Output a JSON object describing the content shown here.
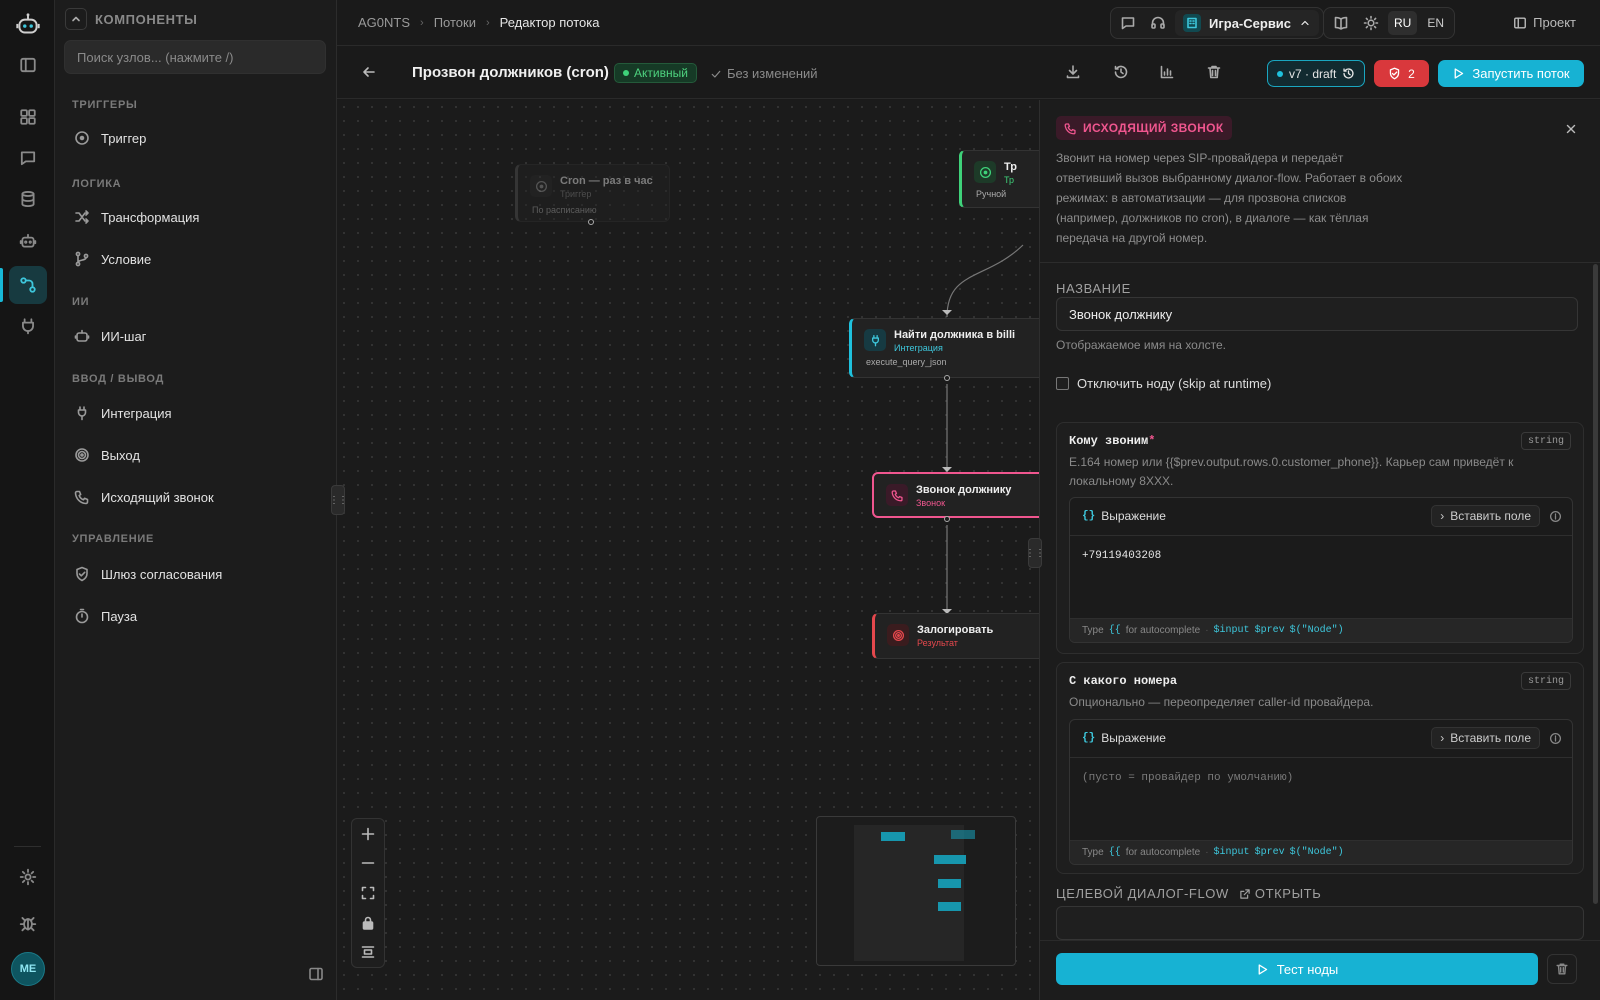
{
  "rail": {
    "avatar": "ME"
  },
  "sidebar": {
    "title": "КОМПОНЕНТЫ",
    "search_placeholder": "Поиск узлов... (нажмите /)",
    "groups": [
      {
        "label": "ТРИГГЕРЫ",
        "items": [
          {
            "label": "Триггер",
            "icon": "trigger-icon"
          }
        ]
      },
      {
        "label": "ЛОГИКА",
        "items": [
          {
            "label": "Трансформация",
            "icon": "shuffle-icon"
          },
          {
            "label": "Условие",
            "icon": "branch-icon"
          }
        ]
      },
      {
        "label": "ИИ",
        "items": [
          {
            "label": "ИИ-шаг",
            "icon": "robot-icon"
          }
        ]
      },
      {
        "label": "ВВОД / ВЫВОД",
        "items": [
          {
            "label": "Интеграция",
            "icon": "plug-icon"
          },
          {
            "label": "Выход",
            "icon": "target-icon"
          },
          {
            "label": "Исходящий звонок",
            "icon": "phone-icon"
          }
        ]
      },
      {
        "label": "УПРАВЛЕНИЕ",
        "items": [
          {
            "label": "Шлюз согласования",
            "icon": "shield-check-icon"
          },
          {
            "label": "Пауза",
            "icon": "timer-icon"
          }
        ]
      }
    ]
  },
  "topbar": {
    "breadcrumbs": [
      "AG0NTS",
      "Потоки",
      "Редактор потока"
    ],
    "tenant": "Игра-Сервис",
    "lang_ru": "RU",
    "lang_en": "EN",
    "project": "Проект"
  },
  "flow": {
    "title": "Прозвон должников (cron)",
    "status": "Активный",
    "saved": "Без изменений",
    "version": "v7 · draft",
    "alerts": "2",
    "run": "Запустить поток"
  },
  "canvas": {
    "nodes": [
      {
        "title": "Cron — раз в час",
        "subtitle": "Триггер",
        "detail": "По расписанию",
        "color": "#555555"
      },
      {
        "title": "Тр",
        "subtitle": "Тр",
        "detail": "Ручной",
        "color": "#3fd27a"
      },
      {
        "title": "Найти должника в billi",
        "subtitle": "Интеграция",
        "detail": "execute_query_json",
        "color": "#1fc1dd"
      },
      {
        "title": "Звонок должнику",
        "subtitle": "Звонок",
        "color": "#f0568f"
      },
      {
        "title": "Залогировать",
        "subtitle": "Результат",
        "color": "#e5484d"
      }
    ]
  },
  "panel": {
    "type": "ИСХОДЯЩИЙ ЗВОНОК",
    "description": "Звонит на номер через SIP-провайдера и передаёт ответивший вызов выбранному диалог-flow. Работает в обоих режимах: в автоматизации — для прозвона списков (например, должников по cron), в диалоге — как тёплая передача на другой номер.",
    "name_label": "НАЗВАНИЕ",
    "name_value": "Звонок должнику",
    "name_hint": "Отображаемое имя на холсте.",
    "disable_label": "Отключить ноду (skip at runtime)",
    "fields": [
      {
        "title": "Кому звоним",
        "required": "*",
        "type": "string",
        "desc": "E.164 номер или {{$prev.output.rows.0.customer_phone}}. Карьер сам приведёт к локальному 8XXX.",
        "mode": "Выражение",
        "insert": "Вставить поле",
        "value": "+79119403208",
        "placeholder": ""
      },
      {
        "title": "С какого номера",
        "required": "",
        "type": "string",
        "desc": "Опционально — переопределяет caller-id провайдера.",
        "mode": "Выражение",
        "insert": "Вставить поле",
        "value": "",
        "placeholder": "(пусто = провайдер по умолчанию)"
      }
    ],
    "footer_type": "Type",
    "footer_token": "{{",
    "footer_auto": "for autocomplete",
    "footer_vars": [
      "$input",
      "$prev",
      "$(\"Node\")"
    ],
    "target_label": "ЦЕЛЕВОЙ ДИАЛОГ-FLOW",
    "open_label": "ОТКРЫТЬ",
    "test_button": "Тест ноды"
  }
}
